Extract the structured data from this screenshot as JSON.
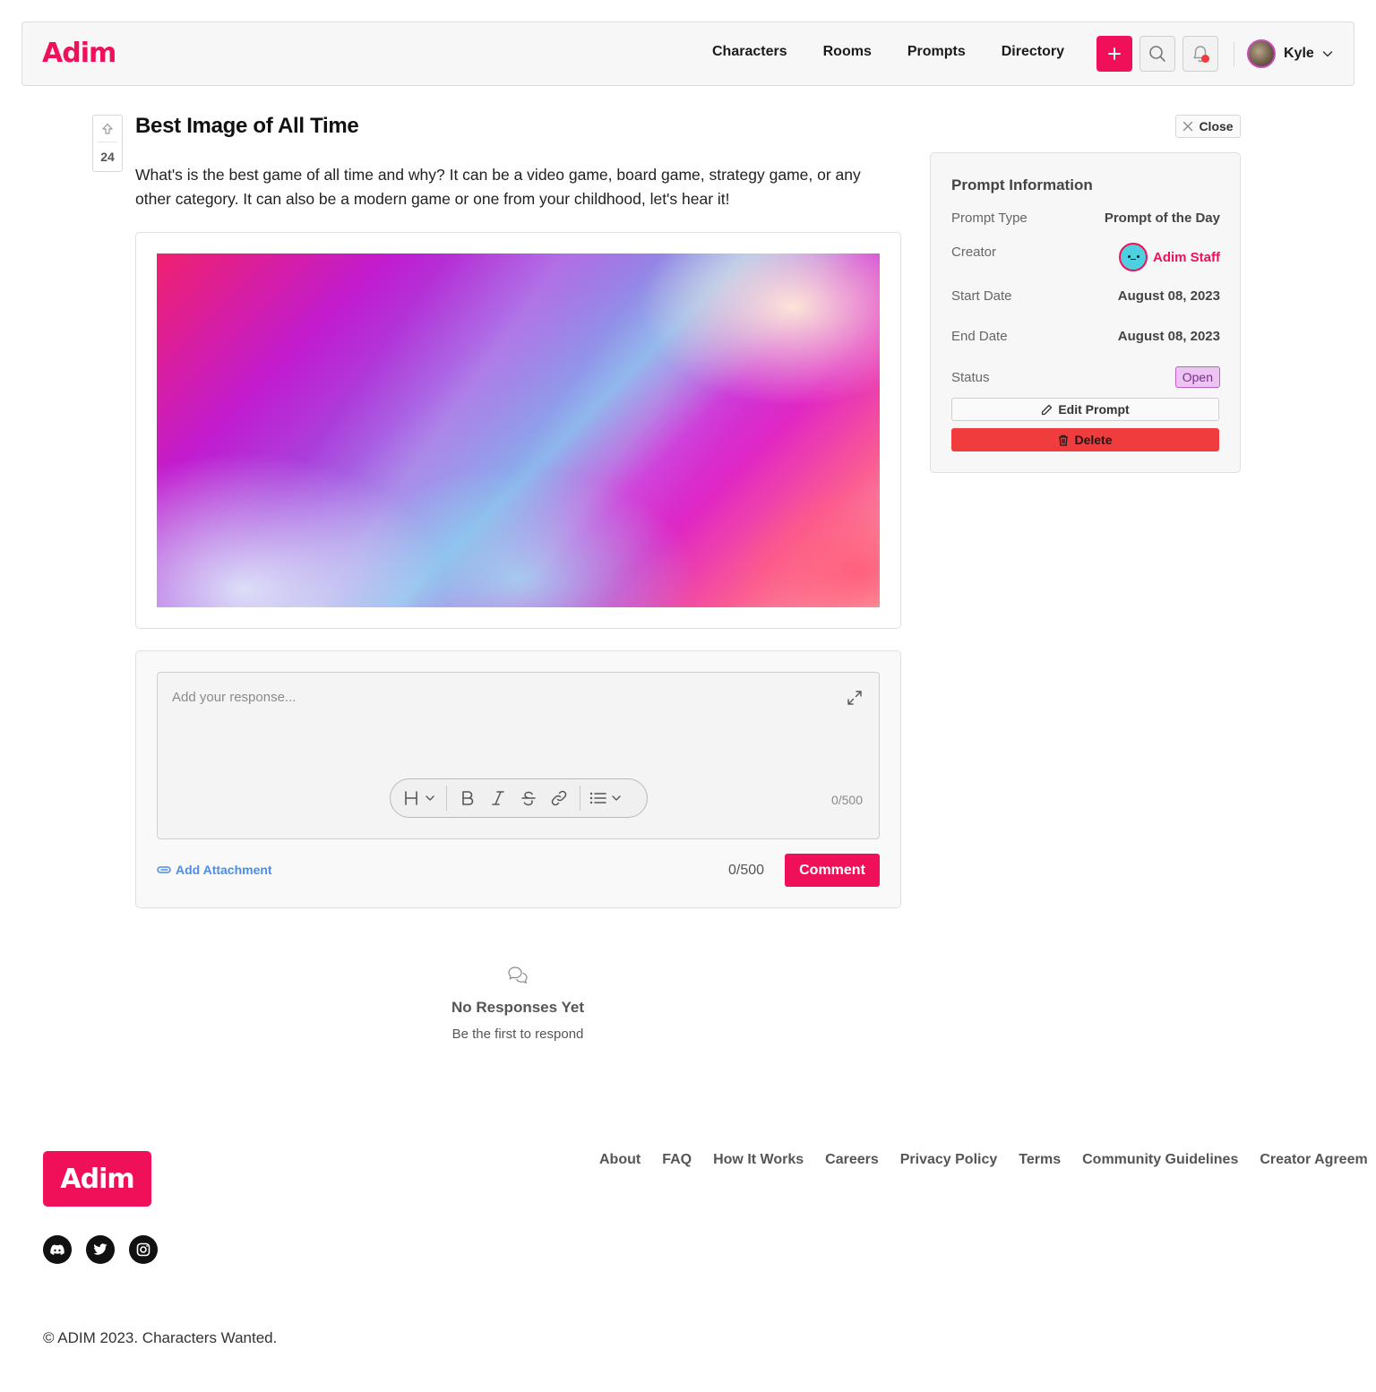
{
  "header": {
    "logo": "Adim",
    "nav": [
      "Characters",
      "Rooms",
      "Prompts",
      "Directory"
    ],
    "user_name": "Kyle",
    "icons": {
      "add": "plus-icon",
      "search": "search-icon",
      "notifications": "bell-icon"
    }
  },
  "prompt": {
    "votes": "24",
    "title": "Best Image of All Time",
    "description": "What's is the best game of all time and why? It can be a video game, board game, strategy game, or any other category. It can also be a modern game or one from your childhood, let's hear it!"
  },
  "close_label": "Close",
  "response": {
    "placeholder": "Add your response...",
    "editor_count": "0/500",
    "attach_label": "Add Attachment",
    "count": "0/500",
    "comment_label": "Comment",
    "toolbar": [
      "heading",
      "bold",
      "italic",
      "strikethrough",
      "link",
      "list"
    ]
  },
  "empty_state": {
    "title": "No Responses Yet",
    "subtitle": "Be the first to respond"
  },
  "info": {
    "title": "Prompt Information",
    "prompt_type_label": "Prompt Type",
    "prompt_type_value": "Prompt of the Day",
    "creator_label": "Creator",
    "creator_name": "Adim Staff",
    "start_label": "Start Date",
    "start_value": "August 08, 2023",
    "end_label": "End Date",
    "end_value": "August 08, 2023",
    "status_label": "Status",
    "status_value": "Open",
    "edit_label": "Edit Prompt",
    "delete_label": "Delete"
  },
  "footer": {
    "logo": "Adim",
    "links": [
      "About",
      "FAQ",
      "How It Works",
      "Careers",
      "Privacy Policy",
      "Terms",
      "Community Guidelines",
      "Creator Agreem"
    ],
    "social": [
      "discord-icon",
      "twitter-icon",
      "instagram-icon"
    ],
    "copyright": "© ADIM 2023. Characters Wanted."
  },
  "colors": {
    "brand": "#f0105a",
    "danger": "#f03c3c",
    "link": "#4a8ee6"
  }
}
